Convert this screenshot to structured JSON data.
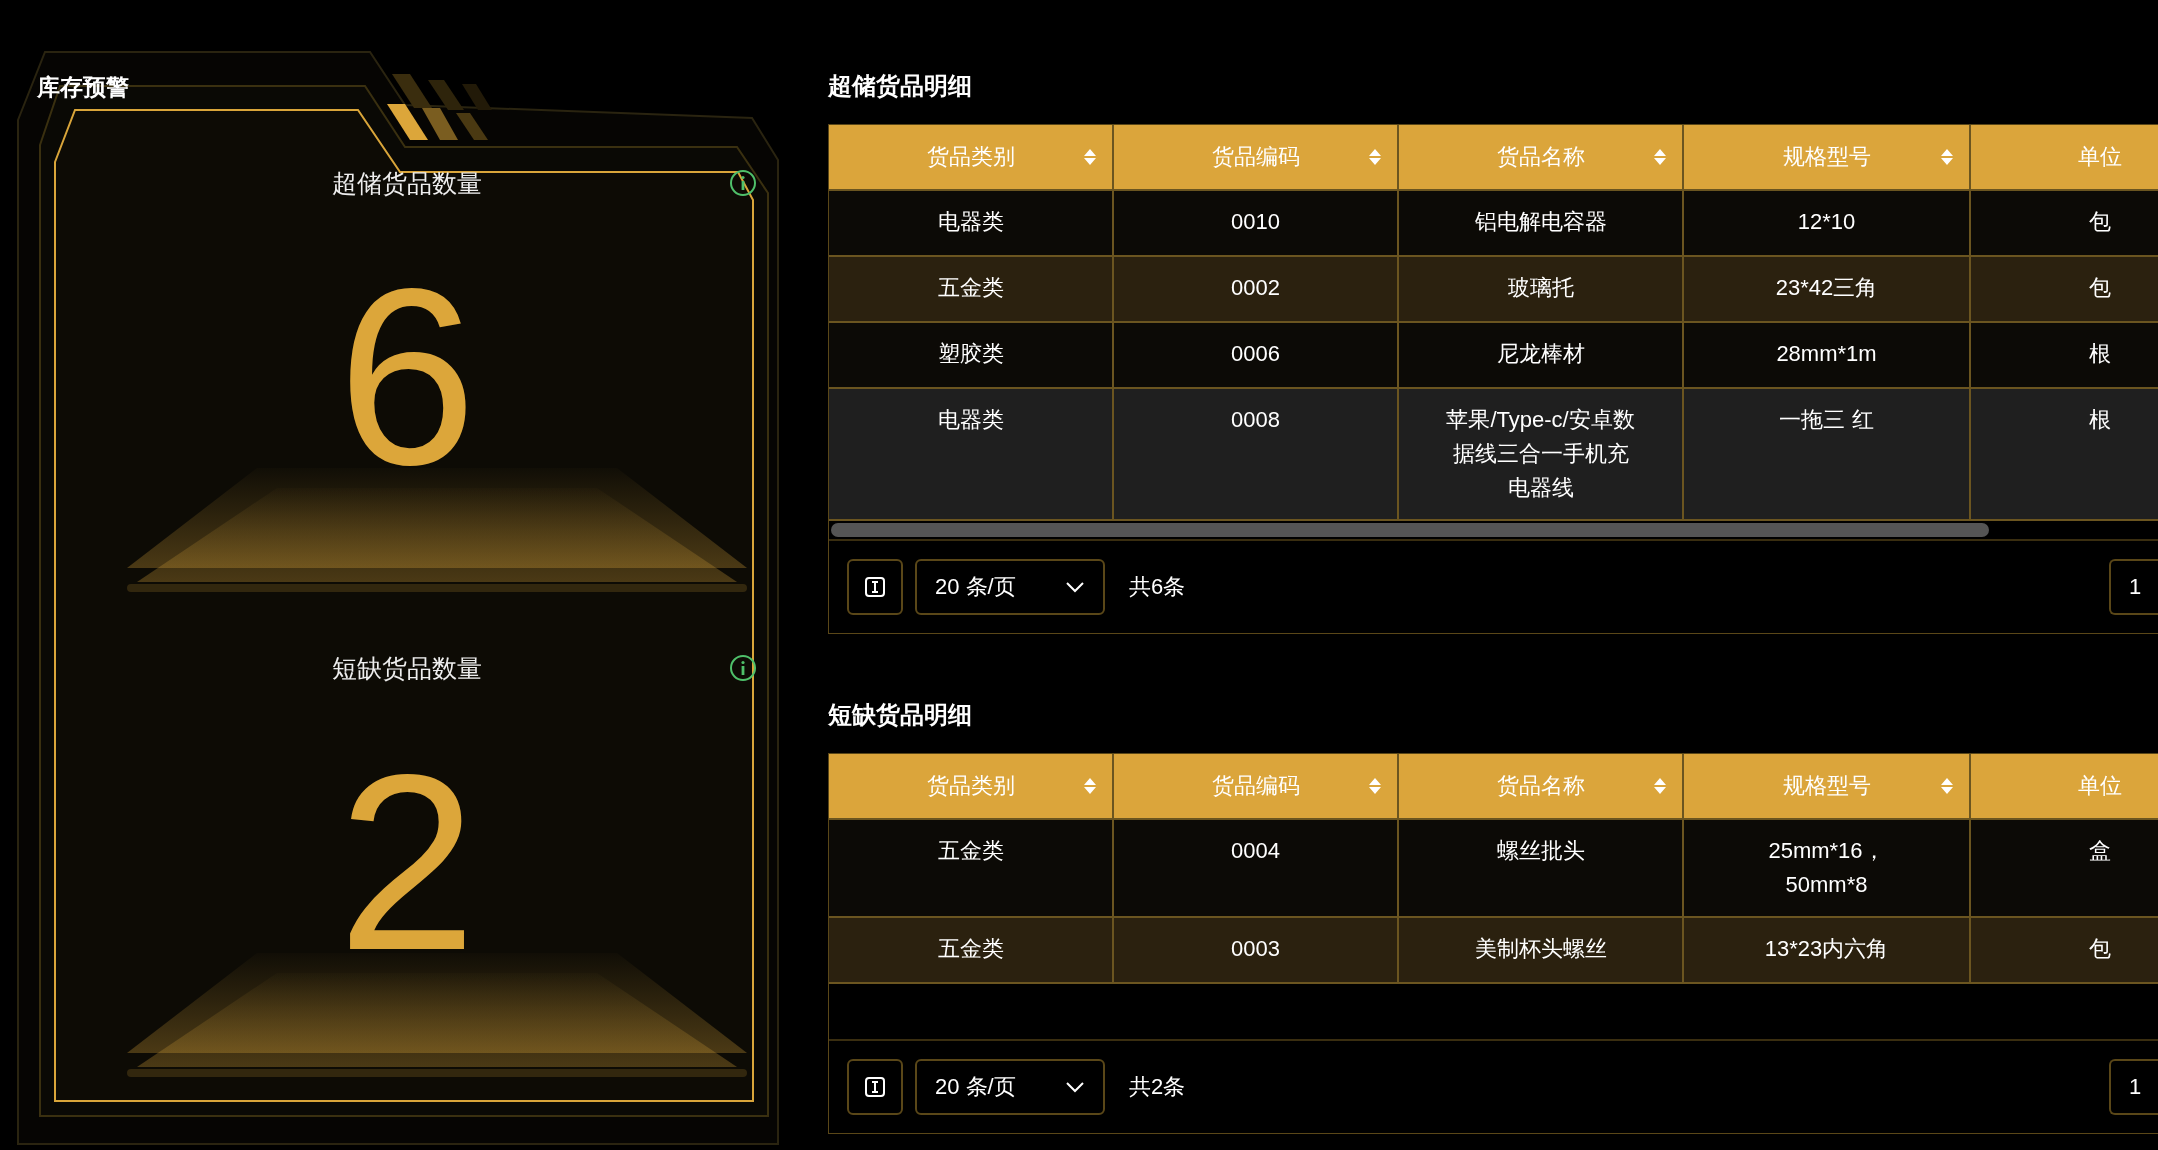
{
  "panel": {
    "title": "库存预警",
    "stats": [
      {
        "label": "超储货品数量",
        "value": "6"
      },
      {
        "label": "短缺货品数量",
        "value": "2"
      }
    ]
  },
  "tables": [
    {
      "title": "超储货品明细",
      "columns": [
        {
          "label": "货品类别",
          "sortable": true
        },
        {
          "label": "货品编码",
          "sortable": true
        },
        {
          "label": "货品名称",
          "sortable": true
        },
        {
          "label": "规格型号",
          "sortable": true
        },
        {
          "label": "单位"
        }
      ],
      "rows": [
        {
          "cells": [
            "电器类",
            "0010",
            "铝电解电容器",
            "12*10",
            "包"
          ],
          "hovered": false
        },
        {
          "cells": [
            "五金类",
            "0002",
            "玻璃托",
            "23*42三角",
            "包"
          ],
          "hovered": false
        },
        {
          "cells": [
            "塑胶类",
            "0006",
            "尼龙棒材",
            "28mm*1m",
            "根"
          ],
          "hovered": false
        },
        {
          "cells": [
            "电器类",
            "0008",
            "苹果/Type-c/安卓数据线三合一手机充电器线",
            "一拖三 红",
            "根"
          ],
          "hovered": true
        }
      ],
      "pagination": {
        "page_size": "20 条/页",
        "total": "共6条",
        "page": "1"
      }
    },
    {
      "title": "短缺货品明细",
      "columns": [
        {
          "label": "货品类别",
          "sortable": true
        },
        {
          "label": "货品编码",
          "sortable": true
        },
        {
          "label": "货品名称",
          "sortable": true
        },
        {
          "label": "规格型号",
          "sortable": true
        },
        {
          "label": "单位"
        }
      ],
      "rows": [
        {
          "cells": [
            "五金类",
            "0004",
            "螺丝批头",
            "25mm*16，50mm*8",
            "盒"
          ],
          "hovered": false
        },
        {
          "cells": [
            "五金类",
            "0003",
            "美制杯头螺丝",
            "13*23内六角",
            "包"
          ],
          "hovered": false
        }
      ],
      "pagination": {
        "page_size": "20 条/页",
        "total": "共2条",
        "page": "1"
      }
    }
  ]
}
